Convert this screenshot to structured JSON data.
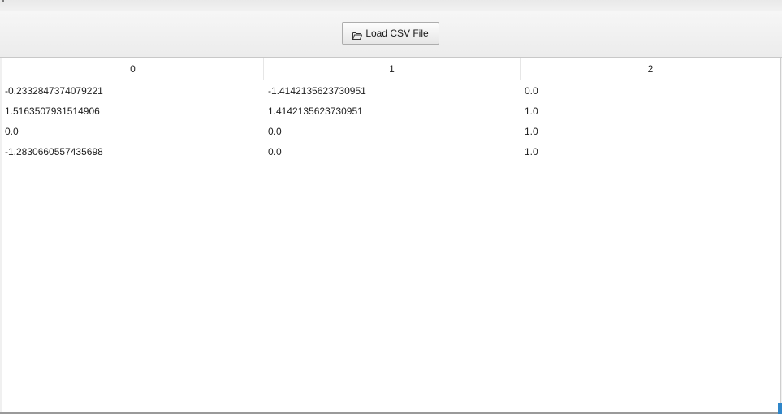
{
  "toolbar": {
    "load_button_label": "Load CSV File",
    "load_button_icon": "folder-open-icon"
  },
  "table": {
    "columns": [
      "0",
      "1",
      "2"
    ],
    "rows": [
      [
        "-0.2332847374079221",
        "-1.4142135623730951",
        "0.0"
      ],
      [
        "1.5163507931514906",
        "1.4142135623730951",
        "1.0"
      ],
      [
        "0.0",
        "0.0",
        "1.0"
      ],
      [
        "-1.2830660557435698",
        "0.0",
        "1.0"
      ]
    ]
  },
  "colors": {
    "background": "#f0f0f0",
    "table_background": "#ffffff",
    "accent": "#2f86c9"
  }
}
